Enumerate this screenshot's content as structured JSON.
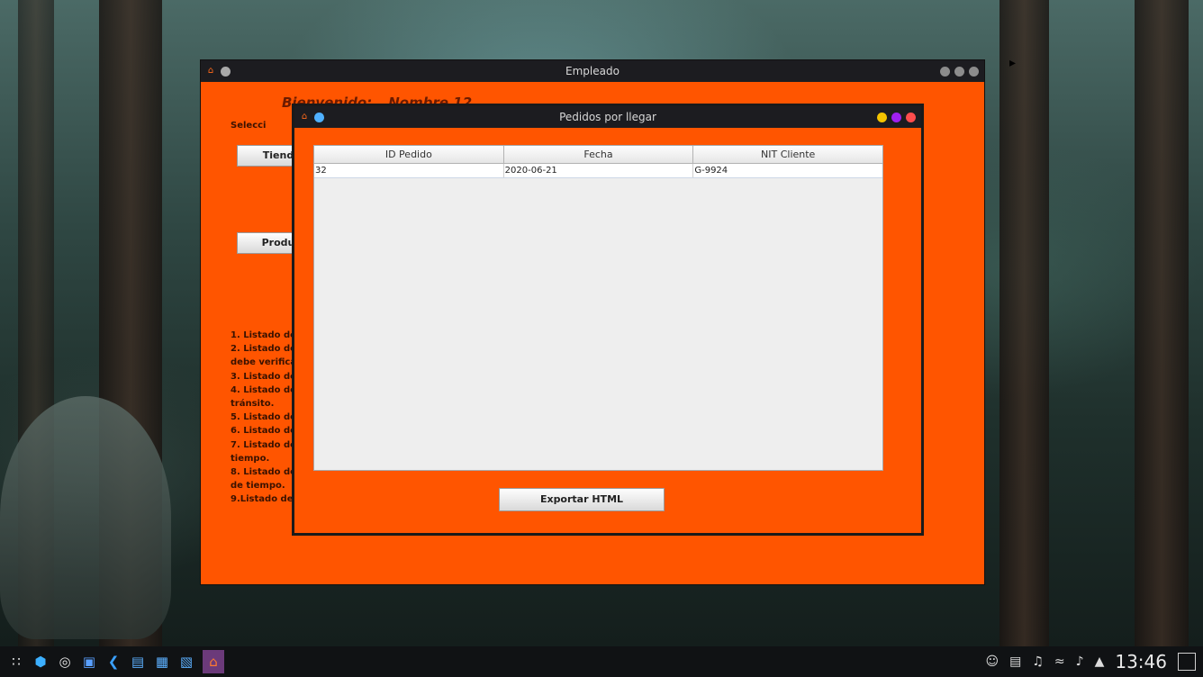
{
  "main_window": {
    "title": "Empleado",
    "welcome": "Bienvenido:",
    "user_name": "Nombre 12",
    "select_label": "Selecci",
    "tiendas_button": "Tiend",
    "productos_button": "Produ",
    "list_lines": [
      "1. Listado de",
      "2. Listado de",
      "debe verifica",
      "3. Listado de",
      "4. Listado de",
      "tránsito.",
      "5. Listado de",
      "6. Listado de",
      "7. Listado de",
      "tiempo.",
      "8. Listado de",
      "de tiempo.",
      "9.Listado de"
    ]
  },
  "dialog": {
    "title": "Pedidos por llegar",
    "table": {
      "columns": [
        "ID Pedido",
        "Fecha",
        "NIT Cliente"
      ],
      "rows": [
        [
          "32",
          "2020-06-21",
          "G-9924"
        ]
      ]
    },
    "export_button": "Exportar HTML"
  },
  "taskbar": {
    "clock": "13:46",
    "icons": [
      "apps-grid-icon",
      "cube-icon",
      "chrome-icon",
      "screen-icon",
      "vscode-icon",
      "terminal-icon",
      "toolbox-icon",
      "save-icon",
      "java-app-icon"
    ]
  },
  "colors": {
    "window_bg": "#ff5500",
    "titlebar": "#1c1c20",
    "dot_yellow": "#f5c400",
    "dot_purple": "#a020f0",
    "dot_red": "#ff4d4d",
    "dot_blue": "#4fb0ff"
  }
}
